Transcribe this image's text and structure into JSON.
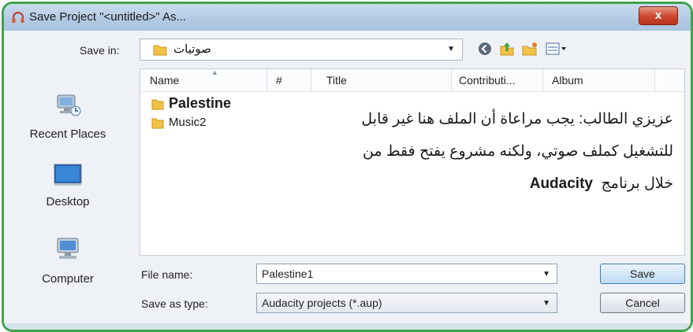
{
  "window": {
    "title": "Save Project \"<untitled>\" As...",
    "close_label": "x"
  },
  "toolbar": {
    "save_in_label": "Save in:",
    "save_in_value": "صوتيات",
    "icons": [
      "back-icon",
      "up-folder-icon",
      "new-folder-icon",
      "views-menu-icon"
    ]
  },
  "places": [
    {
      "label": "Recent Places",
      "icon": "recent-places-icon"
    },
    {
      "label": "Desktop",
      "icon": "desktop-icon"
    },
    {
      "label": "Computer",
      "icon": "computer-icon"
    }
  ],
  "columns": [
    "Name",
    "#",
    "Title",
    "Contributi...",
    "Album"
  ],
  "files": [
    {
      "name": "Palestine",
      "bold": true
    },
    {
      "name": "Music2",
      "bold": false
    }
  ],
  "note": {
    "line1": "عزيزي الطالب: يجب مراعاة أن الملف هنا غير قابل",
    "line2": "للتشغيل كملف صوتي، ولكنه مشروع يفتح فقط من",
    "line3_prefix": "خلال برنامج",
    "line3_app": "Audacity"
  },
  "form": {
    "file_name_label": "File name:",
    "file_name_value": "Palestine1",
    "save_type_label": "Save as type:",
    "save_type_value": "Audacity projects (*.aup)"
  },
  "buttons": {
    "save": "Save",
    "cancel": "Cancel"
  },
  "colors": {
    "frame_border": "#3fa34a",
    "title_gradient": "#b3cbe4",
    "close_button": "#cf4a32"
  }
}
